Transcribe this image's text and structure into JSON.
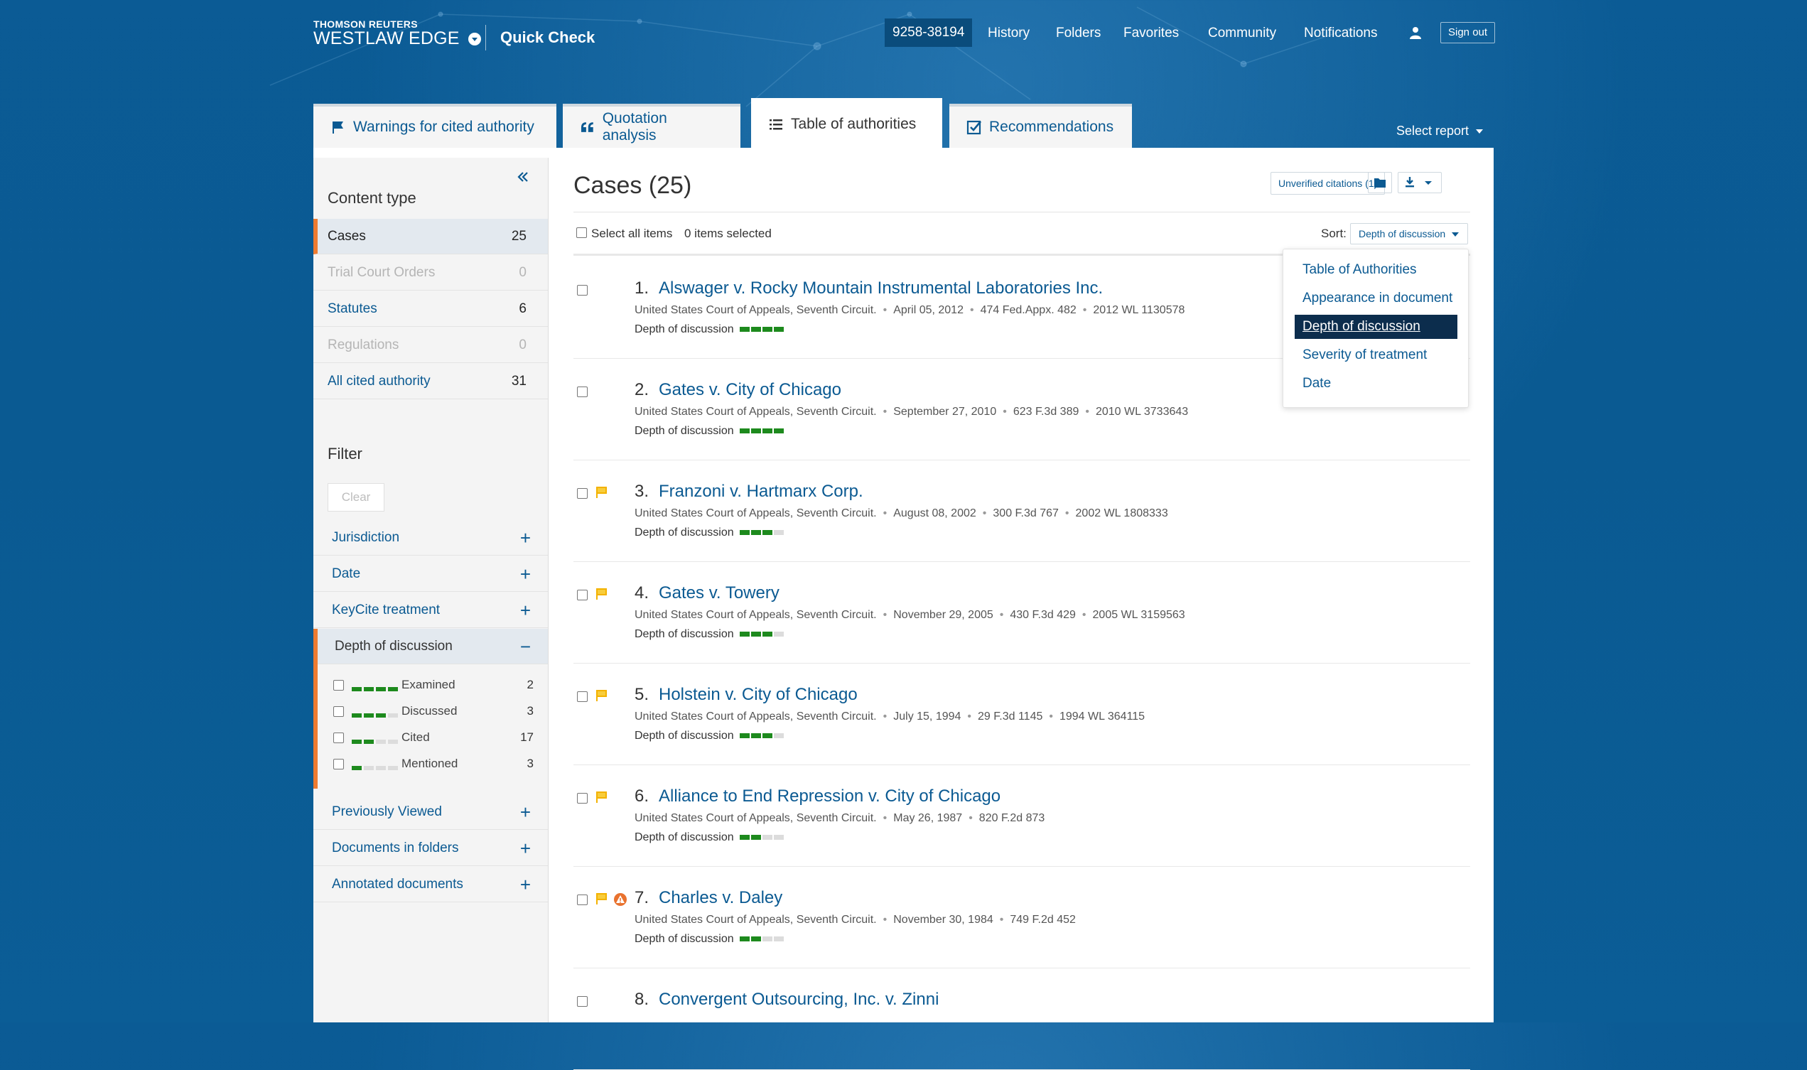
{
  "header": {
    "brand_small": "THOMSON REUTERS",
    "brand_big": "WESTLAW EDGE",
    "product": "Quick Check",
    "client_id": "9258-38194",
    "nav": [
      "History",
      "Folders",
      "Favorites",
      "Community",
      "Notifications"
    ],
    "sign_out": "Sign out"
  },
  "tabs": [
    {
      "label": "Warnings for cited authority",
      "icon": "flag-icon"
    },
    {
      "label": "Quotation analysis",
      "icon": "quote-icon"
    },
    {
      "label": "Table of authorities",
      "icon": "list-icon"
    },
    {
      "label": "Recommendations",
      "icon": "checkbox-icon"
    }
  ],
  "select_report": "Select report",
  "sidebar": {
    "content_type_title": "Content type",
    "content_types": [
      {
        "label": "Cases",
        "count": "25"
      },
      {
        "label": "Trial Court Orders",
        "count": "0"
      },
      {
        "label": "Statutes",
        "count": "6"
      },
      {
        "label": "Regulations",
        "count": "0"
      },
      {
        "label": "All cited authority",
        "count": "31"
      }
    ],
    "filter_title": "Filter",
    "clear_label": "Clear",
    "filters": [
      {
        "label": "Jurisdiction",
        "sign": "+"
      },
      {
        "label": "Date",
        "sign": "+"
      },
      {
        "label": "KeyCite treatment",
        "sign": "+"
      },
      {
        "label": "Depth of discussion",
        "sign": "−"
      },
      {
        "label": "Previously Viewed",
        "sign": "+"
      },
      {
        "label": "Documents in folders",
        "sign": "+"
      },
      {
        "label": "Annotated documents",
        "sign": "+"
      }
    ],
    "depth_options": [
      {
        "label": "Examined",
        "count": "2",
        "level": 4
      },
      {
        "label": "Discussed",
        "count": "3",
        "level": 3
      },
      {
        "label": "Cited",
        "count": "17",
        "level": 2
      },
      {
        "label": "Mentioned",
        "count": "3",
        "level": 1
      }
    ]
  },
  "content": {
    "title": "Cases (25)",
    "unverified": "Unverified citations (1)",
    "select_all": "Select all items",
    "items_selected": "0 items selected",
    "sort_label": "Sort:",
    "sort_value": "Depth of discussion",
    "depth_label": "Depth of discussion",
    "sort_options": [
      "Table of Authorities",
      "Appearance in document",
      "Depth of discussion",
      "Severity of treatment",
      "Date"
    ],
    "cases": [
      {
        "num": "1.",
        "title": "Alswager v. Rocky Mountain Instrumental Laboratories Inc.",
        "court": "United States Court of Appeals, Seventh Circuit.",
        "date": "April 05, 2012",
        "cite1": "474 Fed.Appx. 482",
        "cite2": "2012 WL 1130578",
        "depth": 4,
        "flag": false,
        "warn": false
      },
      {
        "num": "2.",
        "title": "Gates v. City of Chicago",
        "court": "United States Court of Appeals, Seventh Circuit.",
        "date": "September 27, 2010",
        "cite1": "623 F.3d 389",
        "cite2": "2010 WL 3733643",
        "depth": 4,
        "flag": false,
        "warn": false
      },
      {
        "num": "3.",
        "title": "Franzoni v. Hartmarx Corp.",
        "court": "United States Court of Appeals, Seventh Circuit.",
        "date": "August 08, 2002",
        "cite1": "300 F.3d 767",
        "cite2": "2002 WL 1808333",
        "depth": 3,
        "flag": true,
        "warn": false
      },
      {
        "num": "4.",
        "title": "Gates v. Towery",
        "court": "United States Court of Appeals, Seventh Circuit.",
        "date": "November 29, 2005",
        "cite1": "430 F.3d 429",
        "cite2": "2005 WL 3159563",
        "depth": 3,
        "flag": true,
        "warn": false
      },
      {
        "num": "5.",
        "title": "Holstein v. City of Chicago",
        "court": "United States Court of Appeals, Seventh Circuit.",
        "date": "July 15, 1994",
        "cite1": "29 F.3d 1145",
        "cite2": "1994 WL 364115",
        "depth": 3,
        "flag": true,
        "warn": false
      },
      {
        "num": "6.",
        "title": "Alliance to End Repression v. City of Chicago",
        "court": "United States Court of Appeals, Seventh Circuit.",
        "date": "May 26, 1987",
        "cite1": "820 F.2d 873",
        "cite2": "",
        "depth": 2,
        "flag": true,
        "warn": false
      },
      {
        "num": "7.",
        "title": "Charles v. Daley",
        "court": "United States Court of Appeals, Seventh Circuit.",
        "date": "November 30, 1984",
        "cite1": "749 F.2d 452",
        "cite2": "",
        "depth": 2,
        "flag": true,
        "warn": true
      },
      {
        "num": "8.",
        "title": "Convergent Outsourcing, Inc. v. Zinni",
        "court": "",
        "date": "",
        "cite1": "",
        "cite2": "",
        "depth": 0,
        "flag": false,
        "warn": false
      }
    ]
  },
  "colors": {
    "accent": "#0b5a92",
    "bar_on": "#1d8a1d",
    "flag": "#f3b200",
    "warn": "#e9722e",
    "selected_edge": "#ee7b30"
  }
}
